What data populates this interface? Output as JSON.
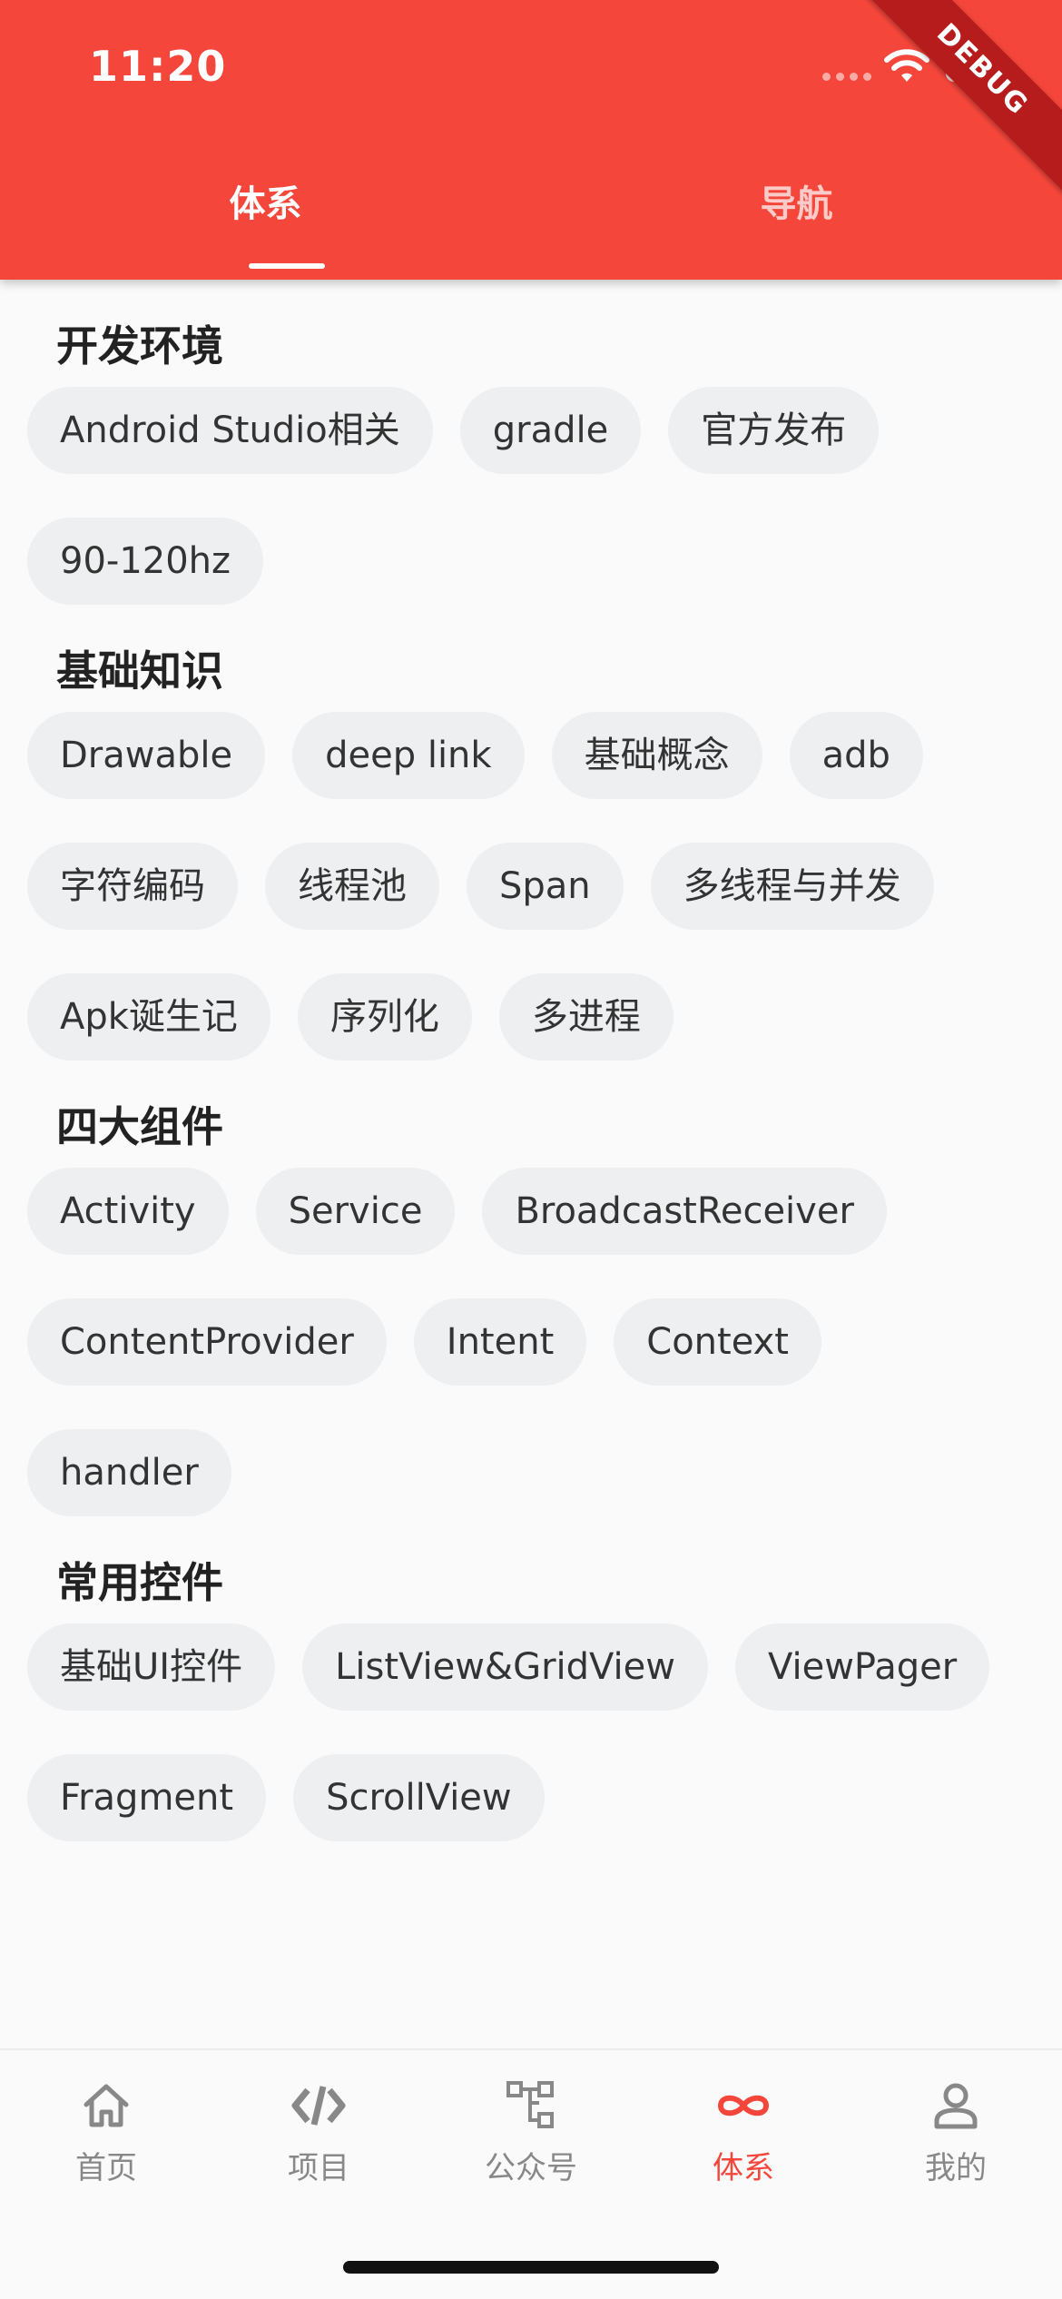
{
  "status_bar": {
    "time": "11:20"
  },
  "debug_banner": "DEBUG",
  "tabs": [
    {
      "label": "体系",
      "selected": true
    },
    {
      "label": "导航",
      "selected": false
    }
  ],
  "sections": [
    {
      "title": "开发环境",
      "chips": [
        "Android Studio相关",
        "gradle",
        "官方发布",
        "90-120hz"
      ]
    },
    {
      "title": "基础知识",
      "chips": [
        "Drawable",
        "deep link",
        "基础概念",
        "adb",
        "字符编码",
        "线程池",
        "Span",
        "多线程与并发",
        "Apk诞生记",
        "序列化",
        "多进程"
      ]
    },
    {
      "title": "四大组件",
      "chips": [
        "Activity",
        "Service",
        "BroadcastReceiver",
        "ContentProvider",
        "Intent",
        "Context",
        "handler"
      ]
    },
    {
      "title": "常用控件",
      "chips": [
        "基础UI控件",
        "ListView&GridView",
        "ViewPager",
        "Fragment",
        "ScrollView"
      ]
    }
  ],
  "bottom_nav": [
    {
      "label": "首页",
      "icon": "home-icon",
      "active": false
    },
    {
      "label": "项目",
      "icon": "code-icon",
      "active": false
    },
    {
      "label": "公众号",
      "icon": "hierarchy-icon",
      "active": false
    },
    {
      "label": "体系",
      "icon": "infinity-icon",
      "active": true
    },
    {
      "label": "我的",
      "icon": "person-icon",
      "active": false
    }
  ],
  "colors": {
    "primary": "#f5463b",
    "chip_background": "#eeeff1",
    "inactive": "#888888"
  }
}
